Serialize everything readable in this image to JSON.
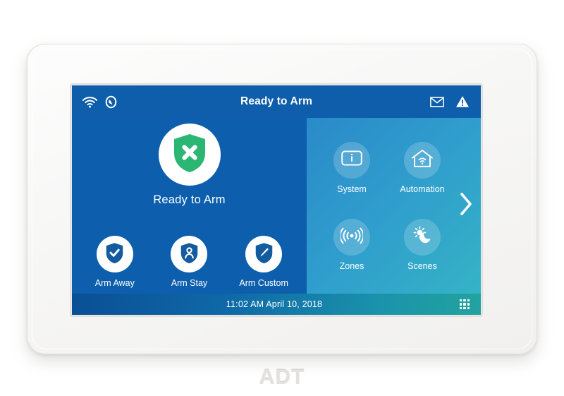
{
  "device": {
    "brand": "ADT",
    "sensor_icon": "camera-sensor-dot"
  },
  "screen": {
    "statusbar": {
      "title": "Ready to Arm",
      "left_icons": [
        {
          "name": "wifi-icon",
          "label": "Wi-Fi connected"
        },
        {
          "name": "cellular-signal-icon",
          "label": "Cellular"
        }
      ],
      "right_icons": [
        {
          "name": "mail-icon",
          "label": "Messages"
        },
        {
          "name": "warning-icon",
          "label": "Trouble alert"
        }
      ]
    },
    "main": {
      "status_tile": {
        "label": "Ready to Arm",
        "icon": "shield-x-icon",
        "icon_color": "#2bb673",
        "circle_color": "#ffffff"
      },
      "arm_options": [
        {
          "label": "Arm Away",
          "icon": "shield-check-icon"
        },
        {
          "label": "Arm Stay",
          "icon": "shield-person-icon"
        },
        {
          "label": "Arm Custom",
          "icon": "shield-pencil-icon"
        }
      ],
      "features": [
        {
          "label": "System",
          "icon": "info-box-icon"
        },
        {
          "label": "Automation",
          "icon": "home-wifi-icon"
        },
        {
          "label": "Zones",
          "icon": "motion-sensor-icon"
        },
        {
          "label": "Scenes",
          "icon": "sun-moon-icon"
        }
      ],
      "next_page": {
        "icon": "chevron-right-icon",
        "label": "Next page"
      }
    },
    "bottombar": {
      "clock": "11:02 AM April 10, 2018",
      "apps_icon": "apps-grid-icon"
    }
  },
  "colors": {
    "panel_blue": "#0d5fae",
    "statusbar_blue": "#0e5eab",
    "accent_teal": "#35b3c6",
    "ready_green": "#2bb673",
    "white": "#ffffff"
  }
}
